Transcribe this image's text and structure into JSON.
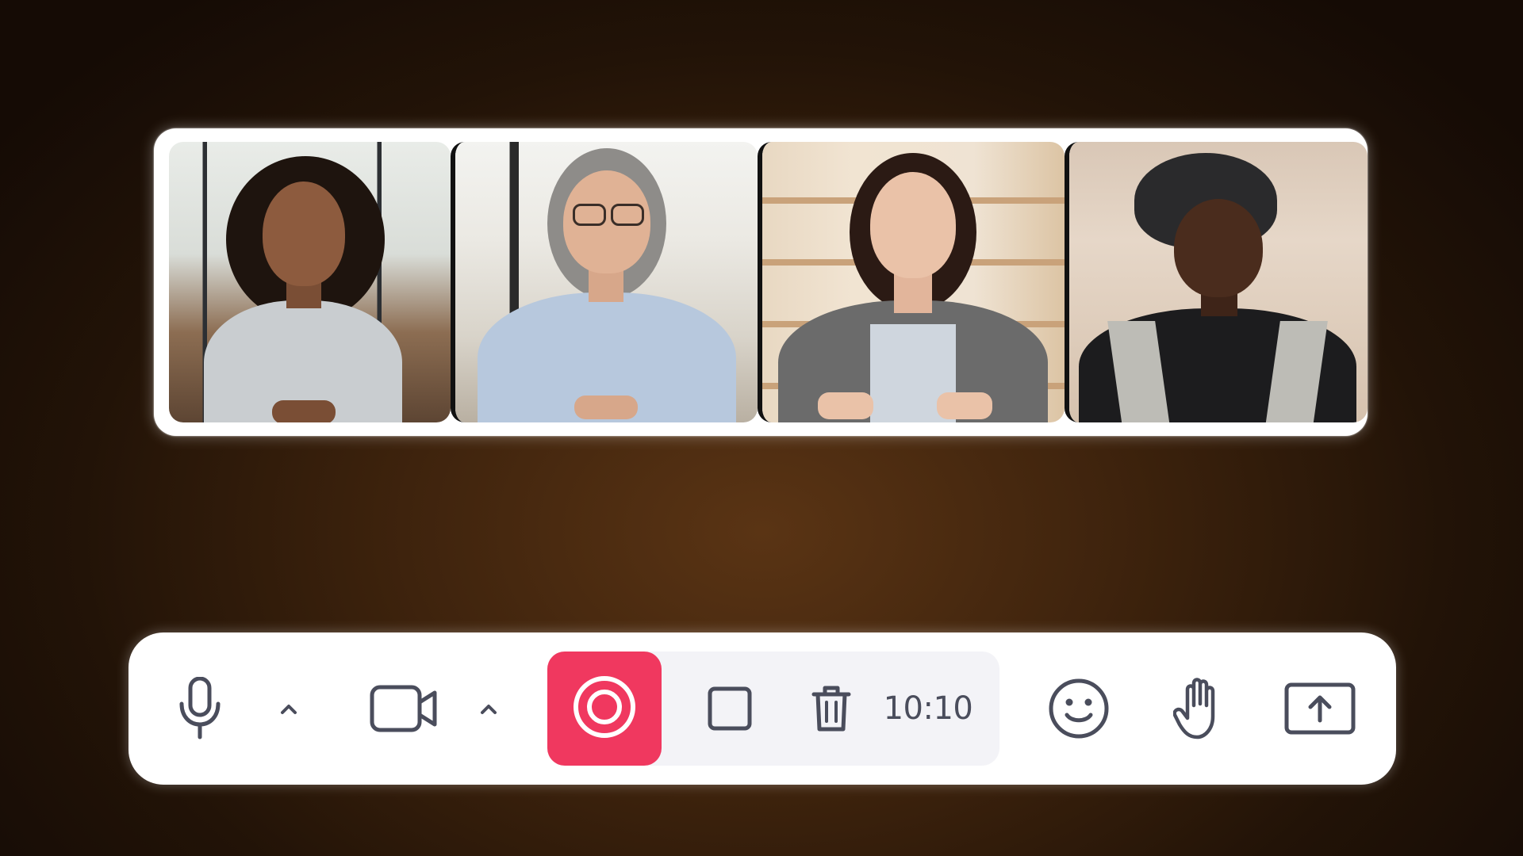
{
  "participants": [
    {
      "name_icon": "participant-video-1"
    },
    {
      "name_icon": "participant-video-2"
    },
    {
      "name_icon": "participant-video-3"
    },
    {
      "name_icon": "participant-video-4"
    }
  ],
  "controls": {
    "microphone_icon": "microphone-icon",
    "mic_options_icon": "chevron-up-icon",
    "camera_icon": "video-camera-icon",
    "camera_options_icon": "chevron-up-icon",
    "record_icon": "record-icon",
    "stop_icon": "stop-icon",
    "delete_icon": "trash-icon",
    "timer": "10:10",
    "reactions_icon": "smiley-icon",
    "raise_hand_icon": "hand-icon",
    "share_screen_icon": "share-screen-icon"
  },
  "colors": {
    "record_accent": "#f0385f",
    "icon_color": "#4a4d5c",
    "control_bar_bg": "#ffffff",
    "record_group_bg": "#f3f3f7",
    "background": "#3e230d"
  }
}
